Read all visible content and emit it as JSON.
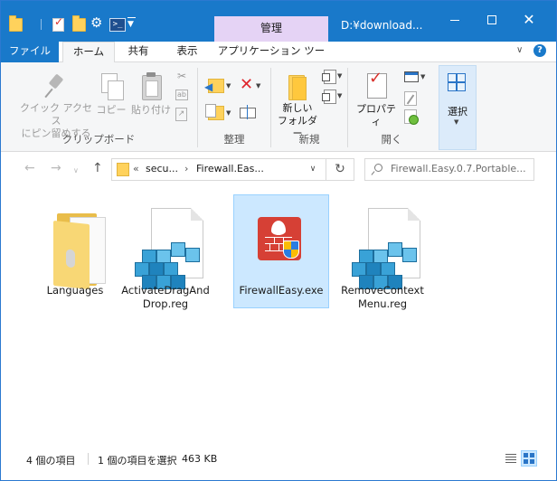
{
  "titlebar": {
    "context_tab_header": "管理",
    "window_title": "D:¥download..."
  },
  "tabs": {
    "file": "ファイル",
    "home": "ホーム",
    "share": "共有",
    "view": "表示",
    "app_tools": "アプリケーション ツール"
  },
  "ribbon": {
    "clipboard": {
      "label": "クリップボード",
      "pin": "クイック アクセス\nにピン留めする",
      "copy": "コピー",
      "paste": "貼り付け"
    },
    "organize": {
      "label": "整理"
    },
    "new": {
      "label": "新規",
      "new_folder": "新しい\nフォルダー"
    },
    "open": {
      "label": "開く",
      "properties": "プロパティ"
    },
    "select": {
      "label": "選択"
    }
  },
  "address": {
    "overflow": "«",
    "crumbs": [
      "secu...",
      "Firewall.Eas..."
    ],
    "search_placeholder": "Firewall.Easy.0.7.Portable..."
  },
  "files": [
    {
      "name": "Languages",
      "type": "folder"
    },
    {
      "name": "ActivateDragAnd\nDrop.reg",
      "type": "reg"
    },
    {
      "name": "FirewallEasy.exe",
      "type": "exe",
      "selected": true
    },
    {
      "name": "RemoveContext\nMenu.reg",
      "type": "reg"
    }
  ],
  "status": {
    "item_count": "4 個の項目",
    "selection": "1 個の項目を選択",
    "size": "463 KB"
  },
  "colors": {
    "titlebar": "#1979ca",
    "context_tab": "#e5d3f5",
    "selection": "#cce8ff"
  }
}
